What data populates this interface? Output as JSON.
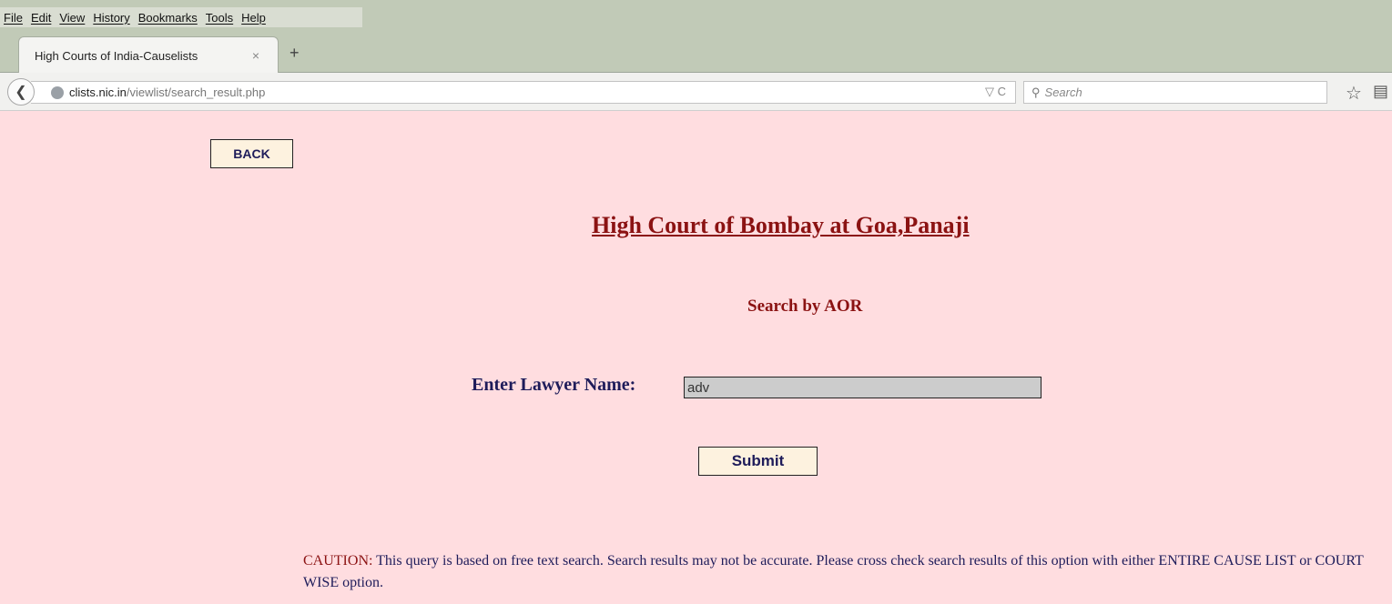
{
  "browser": {
    "menu": [
      "File",
      "Edit",
      "View",
      "History",
      "Bookmarks",
      "Tools",
      "Help"
    ],
    "tab_title": "High Courts of India-Causelists",
    "tab_close": "×",
    "new_tab": "+",
    "url_host": "clists.nic.in",
    "url_path": "/viewlist/search_result.php",
    "url_tools": "▽ C",
    "search_placeholder": "Search"
  },
  "page": {
    "back_label": "BACK",
    "court_title": "High Court of Bombay at Goa,Panaji",
    "subtitle": "Search by AOR",
    "lawyer_label": "Enter Lawyer Name:",
    "lawyer_value": "adv",
    "submit_label": "Submit",
    "caution_word": "CAUTION:",
    "caution_text": " This query is based on free text search. Search results may not be accurate. Please cross check search results of this option with either ENTIRE CAUSE LIST or COURT WISE option."
  },
  "colors": {
    "page_background": "#ffdde0",
    "title_red": "#8b1212",
    "text_navy": "#1e1c5a",
    "button_fill": "#fdf2df",
    "input_fill": "#cccccc",
    "chrome_green": "#c1cab7"
  },
  "icons": {
    "back": "back-arrow-icon",
    "site": "globe-icon",
    "search": "magnifier-icon",
    "bookmark": "star-icon",
    "library": "library-icon"
  }
}
